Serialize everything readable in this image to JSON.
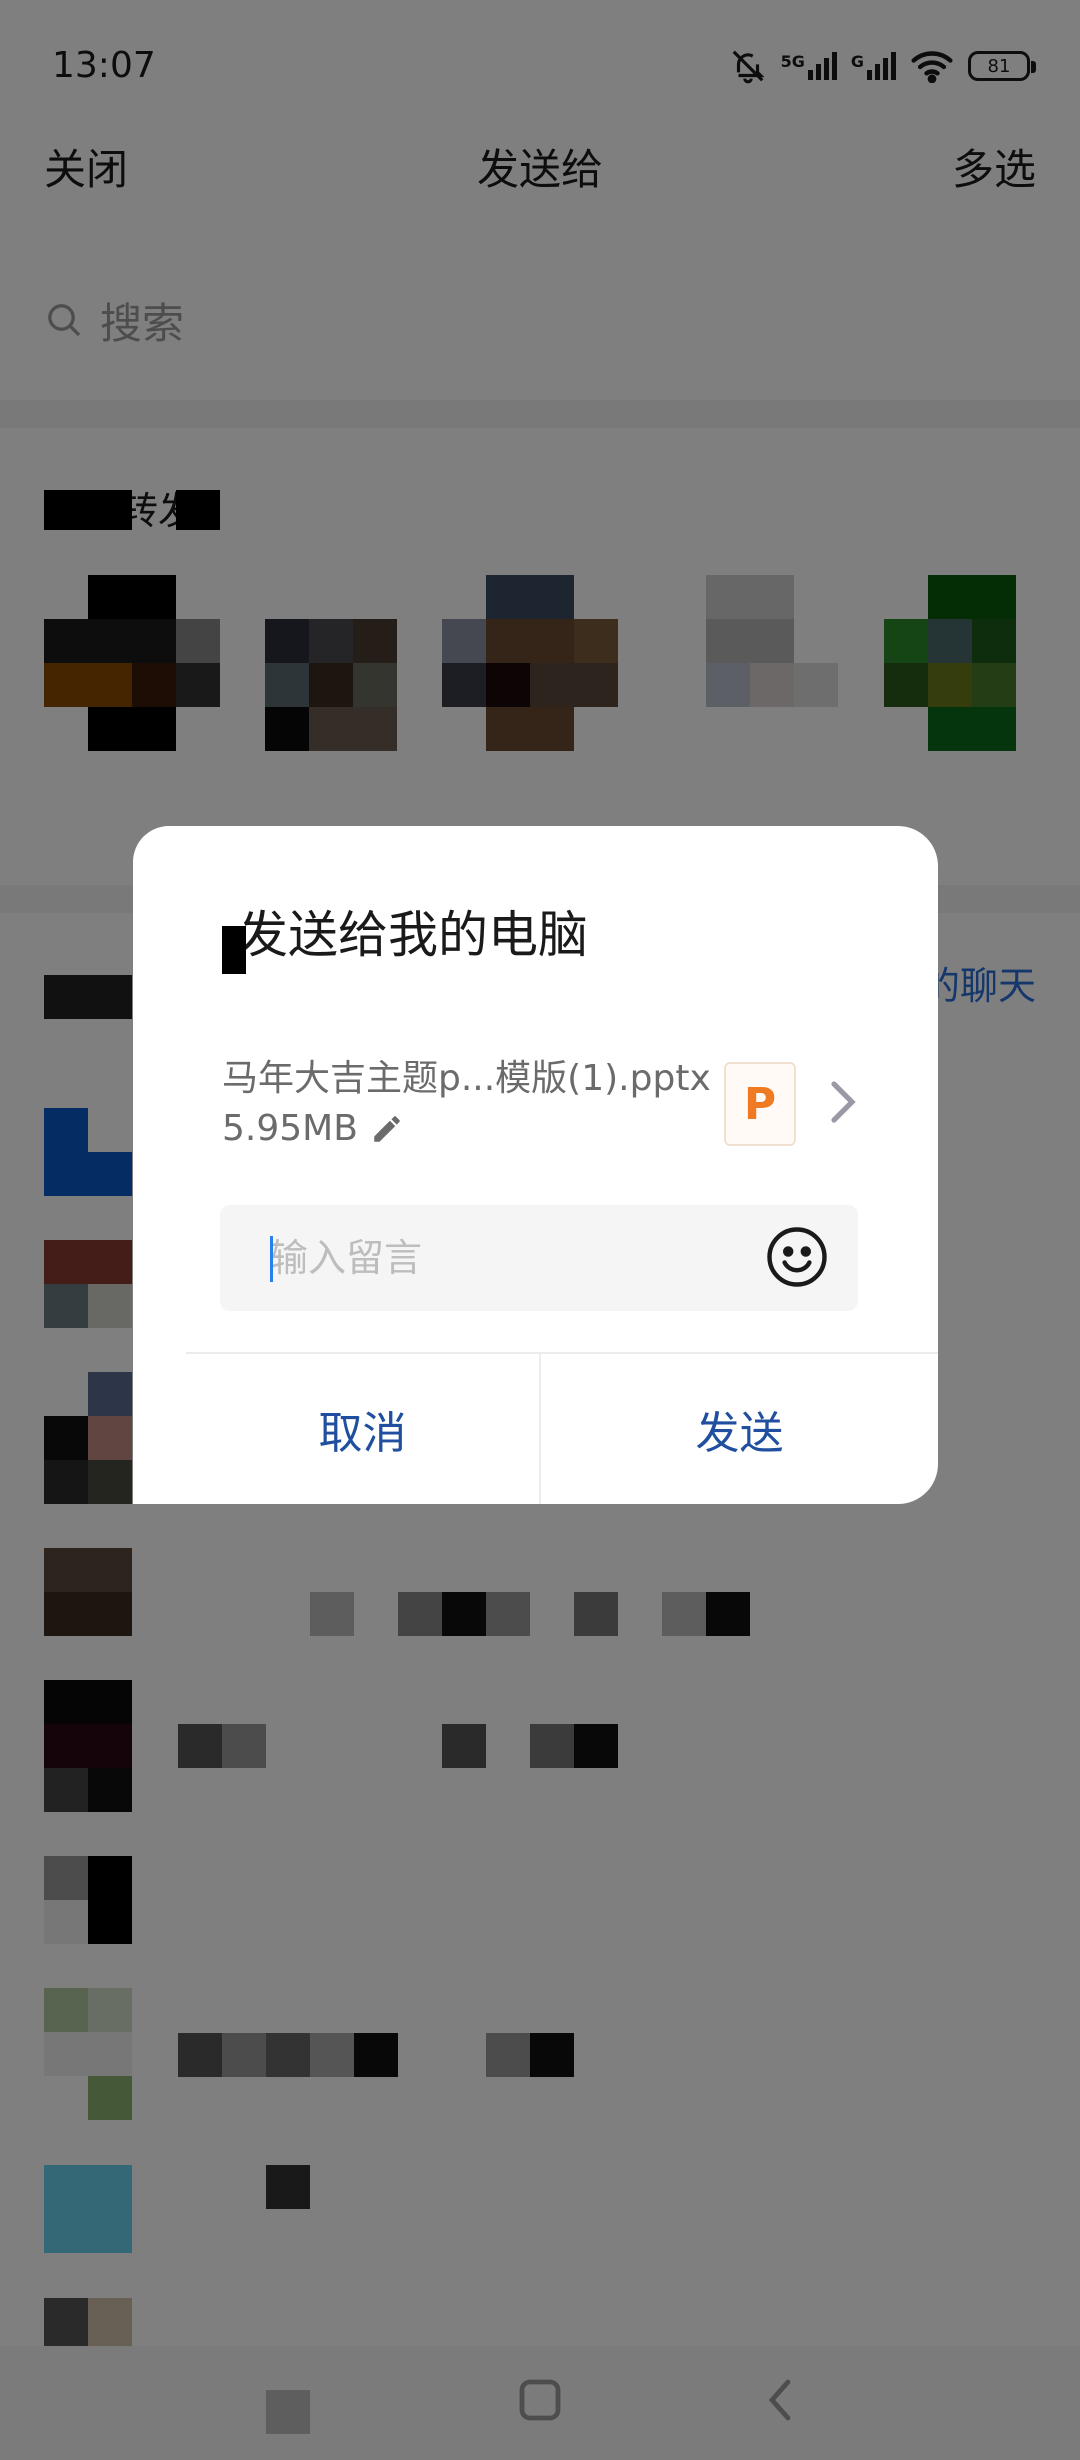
{
  "status_bar": {
    "time": "13:07",
    "network_5g": "5G",
    "network_g": "G",
    "battery": "81"
  },
  "header": {
    "close_label": "关闭",
    "title": "发送给",
    "multi_select_label": "多选"
  },
  "search": {
    "placeholder": "搜索"
  },
  "recent": {
    "section_label": "最近转发"
  },
  "list": {
    "link_text": "的聊天"
  },
  "dialog": {
    "title": "发送给我的电脑",
    "file_name": "马年大吉主题p...模版(1).pptx",
    "file_size": "5.95MB",
    "file_type_badge": "P",
    "message_placeholder": "输入留言",
    "cancel_label": "取消",
    "send_label": "发送"
  },
  "colors": {
    "accent": "#1f4f9e",
    "ppt_orange": "#f07a22",
    "caret": "#2a7ef0"
  },
  "icons": {
    "search": "search-icon",
    "edit": "pencil-icon",
    "chevron": "chevron-right-icon",
    "emoji": "smiley-icon"
  }
}
